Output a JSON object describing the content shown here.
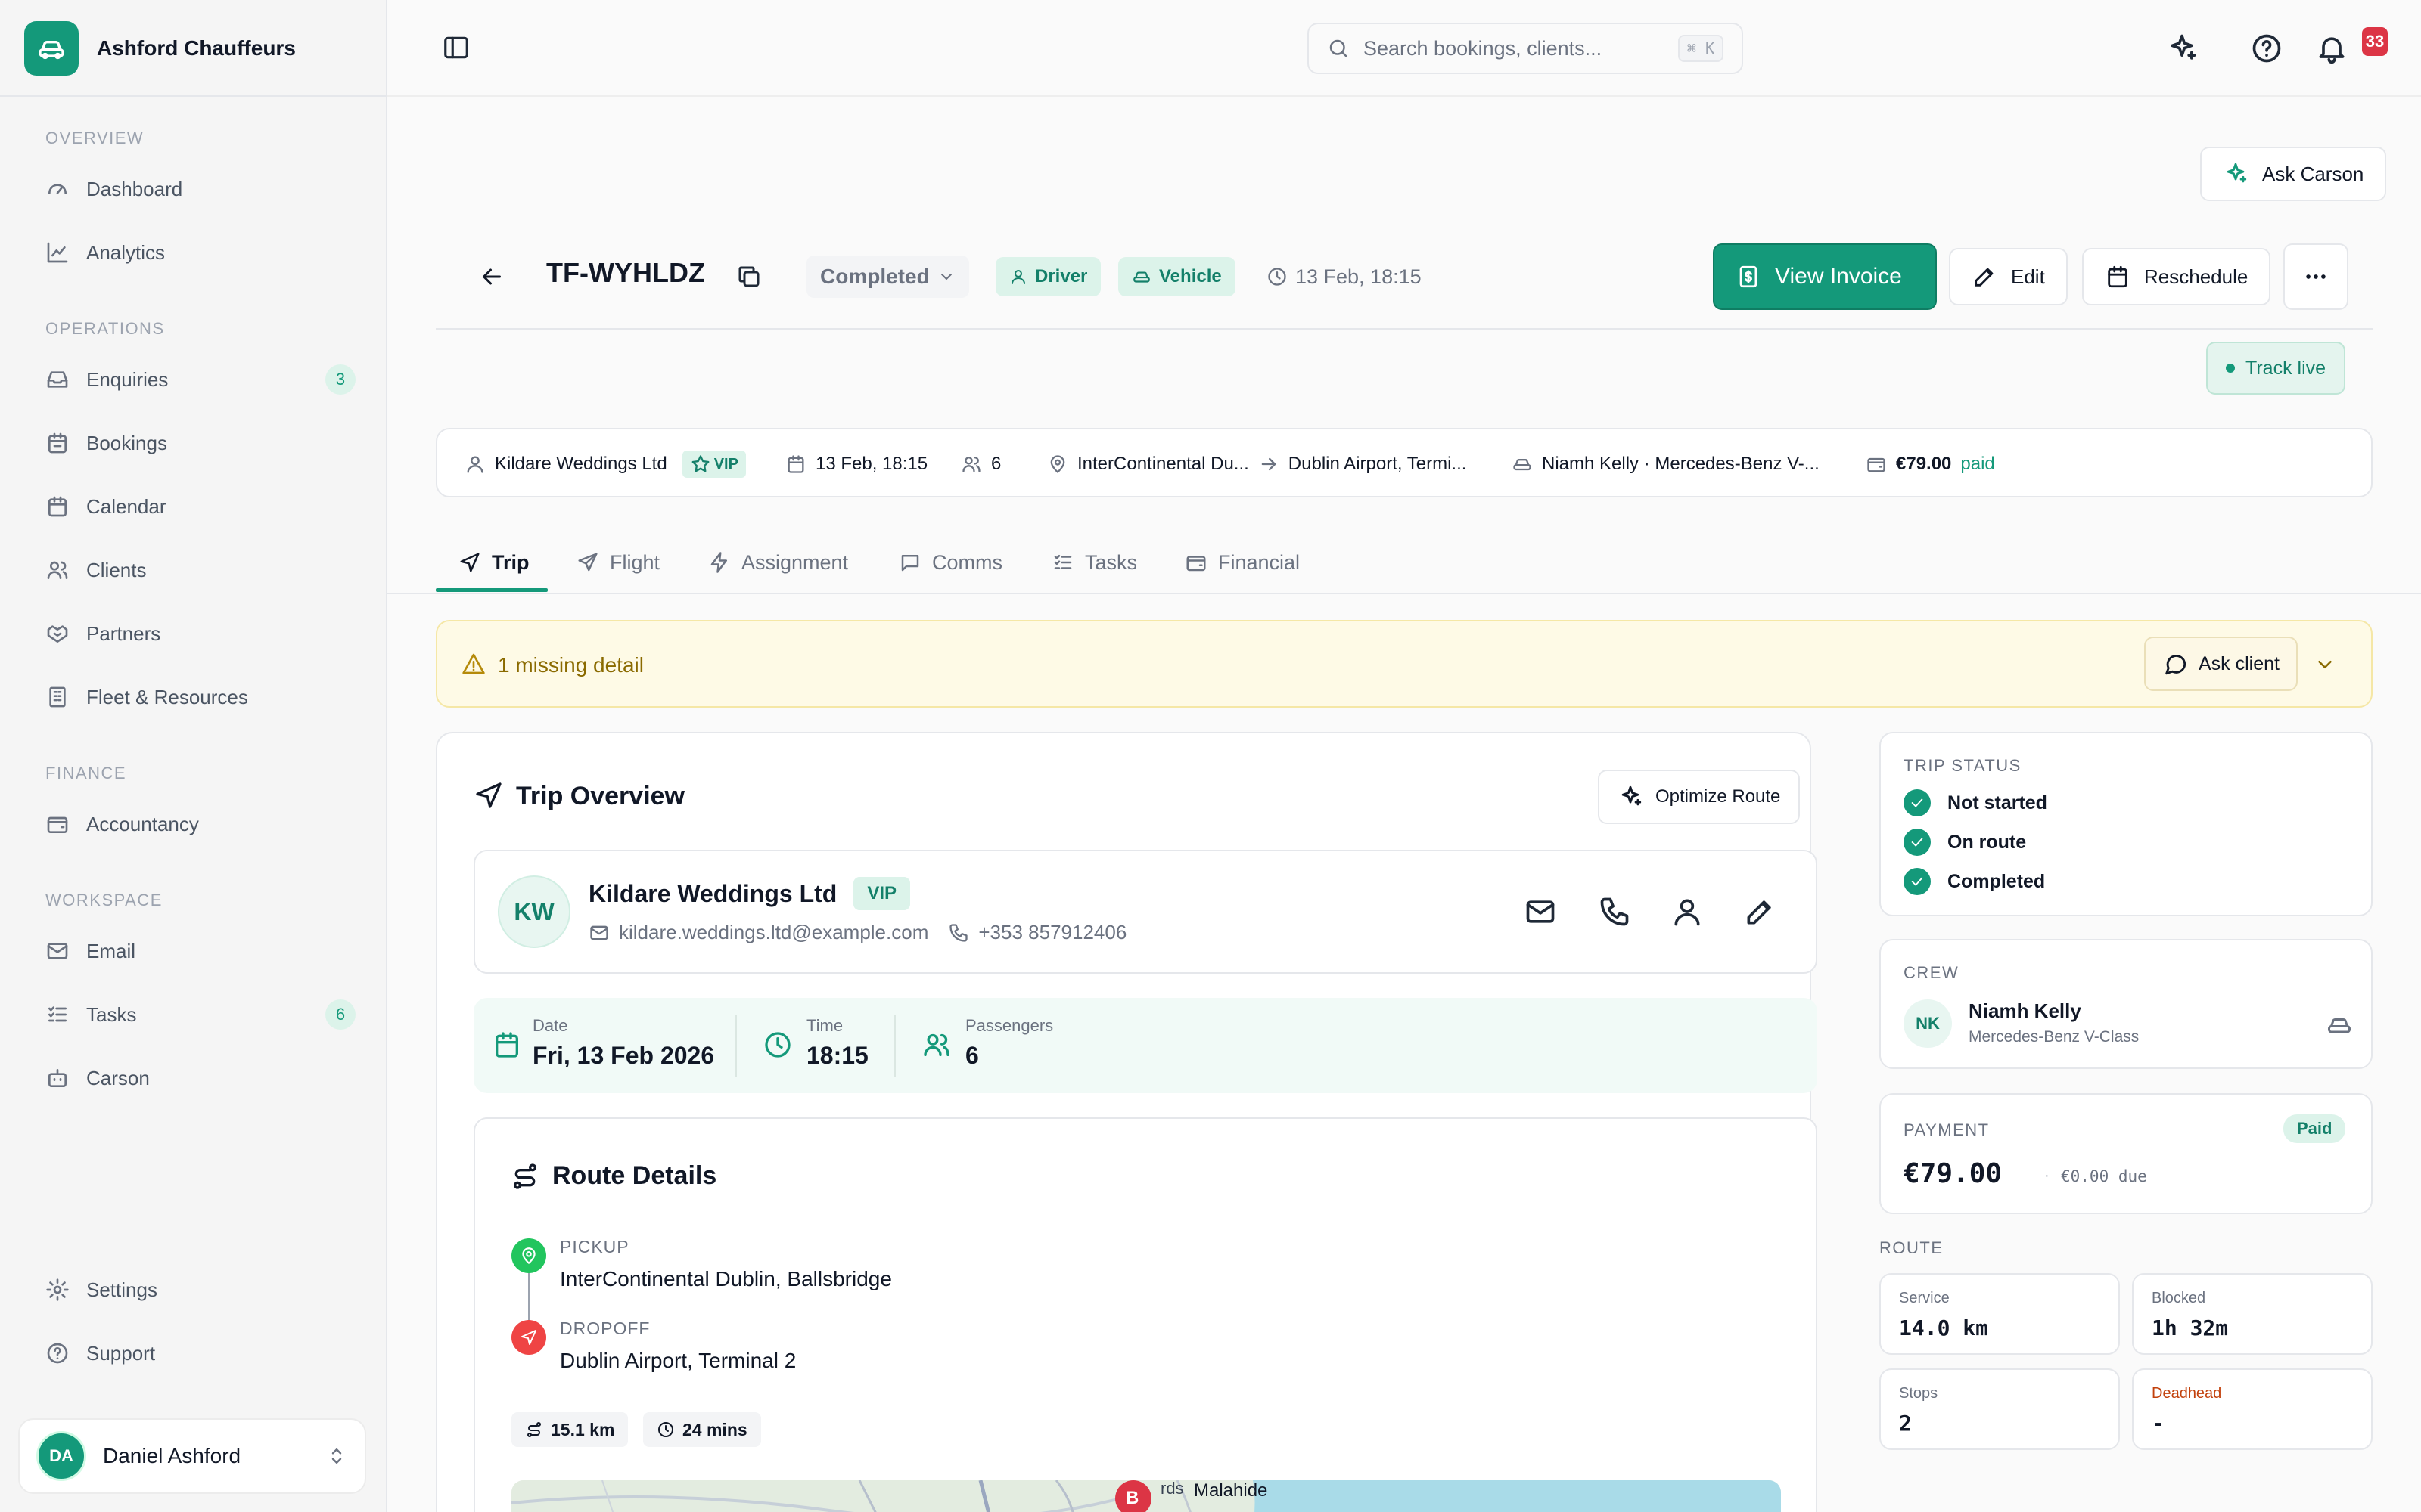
{
  "app": {
    "name": "Ashford Chauffeurs"
  },
  "sidebar": {
    "sections": [
      {
        "title": "OVERVIEW",
        "items": [
          {
            "label": "Dashboard",
            "icon": "gauge-icon"
          },
          {
            "label": "Analytics",
            "icon": "chart-line-icon"
          }
        ]
      },
      {
        "title": "OPERATIONS",
        "items": [
          {
            "label": "Enquiries",
            "icon": "inbox-icon",
            "badge": "3"
          },
          {
            "label": "Bookings",
            "icon": "calendar-check-icon"
          },
          {
            "label": "Calendar",
            "icon": "calendar-icon"
          },
          {
            "label": "Clients",
            "icon": "users-icon"
          },
          {
            "label": "Partners",
            "icon": "handshake-icon"
          },
          {
            "label": "Fleet & Resources",
            "icon": "building-icon"
          }
        ]
      },
      {
        "title": "FINANCE",
        "items": [
          {
            "label": "Accountancy",
            "icon": "wallet-icon"
          }
        ]
      },
      {
        "title": "WORKSPACE",
        "items": [
          {
            "label": "Email",
            "icon": "mail-icon"
          },
          {
            "label": "Tasks",
            "icon": "list-checks-icon",
            "badge": "6"
          },
          {
            "label": "Carson",
            "icon": "bot-icon"
          }
        ]
      }
    ],
    "footer_items": [
      {
        "label": "Settings",
        "icon": "gear-icon"
      },
      {
        "label": "Support",
        "icon": "help-circle-icon"
      }
    ],
    "user": {
      "initials": "DA",
      "name": "Daniel Ashford"
    }
  },
  "topbar": {
    "search_placeholder": "Search bookings, clients...",
    "shortcut": "⌘ K",
    "notification_count": "33"
  },
  "booking": {
    "ask_label": "Ask Carson",
    "id": "TF-WYHLDZ",
    "status": "Completed",
    "driver_tag": "Driver",
    "vehicle_tag": "Vehicle",
    "datetime": "13 Feb, 18:15",
    "actions": {
      "invoice": "View Invoice",
      "edit": "Edit",
      "reschedule": "Reschedule"
    },
    "track_live": "Track live"
  },
  "summary": {
    "client": "Kildare Weddings Ltd",
    "vip": "VIP",
    "date": "13 Feb, 18:15",
    "passengers": "6",
    "pickup": "InterContinental Du...",
    "dropoff": "Dublin Airport, Termi...",
    "driver_vehicle": "Niamh Kelly · Mercedes-Benz V-...",
    "amount": "€79.00",
    "amount_status": "paid"
  },
  "tabs": [
    {
      "label": "Trip",
      "icon": "navigation-icon",
      "active": true
    },
    {
      "label": "Flight",
      "icon": "plane-icon"
    },
    {
      "label": "Assignment",
      "icon": "zap-icon"
    },
    {
      "label": "Comms",
      "icon": "message-icon"
    },
    {
      "label": "Tasks",
      "icon": "list-checks-icon"
    },
    {
      "label": "Financial",
      "icon": "wallet-icon"
    }
  ],
  "warning": {
    "text": "1 missing detail",
    "action": "Ask client"
  },
  "trip_overview": {
    "title": "Trip Overview",
    "optimize": "Optimize Route",
    "client": {
      "initials": "KW",
      "name": "Kildare Weddings Ltd",
      "vip": "VIP",
      "email": "kildare.weddings.ltd@example.com",
      "phone": "+353 857912406"
    },
    "date_label": "Date",
    "date": "Fri, 13 Feb 2026",
    "time_label": "Time",
    "time": "18:15",
    "pax_label": "Passengers",
    "pax": "6"
  },
  "route_details": {
    "title": "Route Details",
    "pickup_label": "PICKUP",
    "pickup": "InterContinental Dublin, Ballsbridge",
    "dropoff_label": "DROPOFF",
    "dropoff": "Dublin Airport, Terminal 2",
    "distance": "15.1 km",
    "duration": "24 mins",
    "map_marker": "B",
    "map_town": "Malahide",
    "map_partial_label": "rds"
  },
  "trip_status": {
    "title": "TRIP STATUS",
    "steps": [
      "Not started",
      "On route",
      "Completed"
    ]
  },
  "crew": {
    "title": "CREW",
    "initials": "NK",
    "name": "Niamh Kelly",
    "vehicle": "Mercedes-Benz V-Class"
  },
  "payment": {
    "title": "PAYMENT",
    "badge": "Paid",
    "amount": "€79.00",
    "separator": "·",
    "due": "€0.00 due"
  },
  "route_stats": {
    "title": "ROUTE",
    "service_label": "Service",
    "service": "14.0 km",
    "blocked_label": "Blocked",
    "blocked": "1h 32m",
    "stops_label": "Stops",
    "stops": "2",
    "deadhead_label": "Deadhead",
    "deadhead": "-"
  },
  "colors": {
    "accent": "#14997a",
    "warning_bg": "#fefae6",
    "danger": "#dc3545"
  }
}
